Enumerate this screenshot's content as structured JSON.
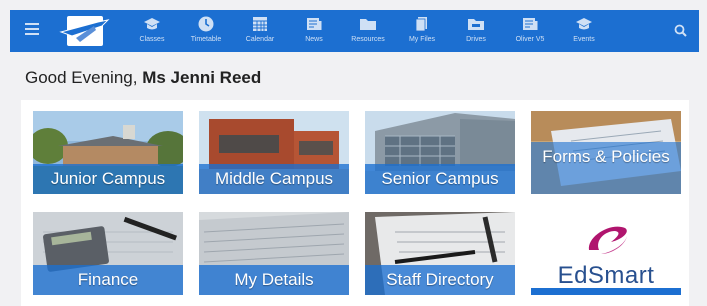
{
  "nav": {
    "items": [
      {
        "label": "Classes",
        "icon": "graduation-cap-icon"
      },
      {
        "label": "Timetable",
        "icon": "clock-icon"
      },
      {
        "label": "Calendar",
        "icon": "calendar-icon"
      },
      {
        "label": "News",
        "icon": "newspaper-icon"
      },
      {
        "label": "Resources",
        "icon": "folder-icon"
      },
      {
        "label": "My Files",
        "icon": "files-icon"
      },
      {
        "label": "Drives",
        "icon": "drive-folder-icon"
      },
      {
        "label": "Oliver V5",
        "icon": "library-icon"
      },
      {
        "label": "Events",
        "icon": "events-cap-icon"
      }
    ]
  },
  "greeting": {
    "prefix": "Good Evening,",
    "name": "Ms Jenni Reed"
  },
  "tiles": [
    {
      "label": "Junior Campus"
    },
    {
      "label": "Middle Campus"
    },
    {
      "label": "Senior Campus"
    },
    {
      "label": "Forms & Policies"
    },
    {
      "label": "Finance"
    },
    {
      "label": "My Details"
    },
    {
      "label": "Staff Directory"
    },
    {
      "label": "EdSmart"
    }
  ],
  "colors": {
    "accent": "#1c6fd1",
    "background": "#f1f1f3",
    "edsmart_magenta": "#b0156e",
    "edsmart_text": "#28508f"
  }
}
